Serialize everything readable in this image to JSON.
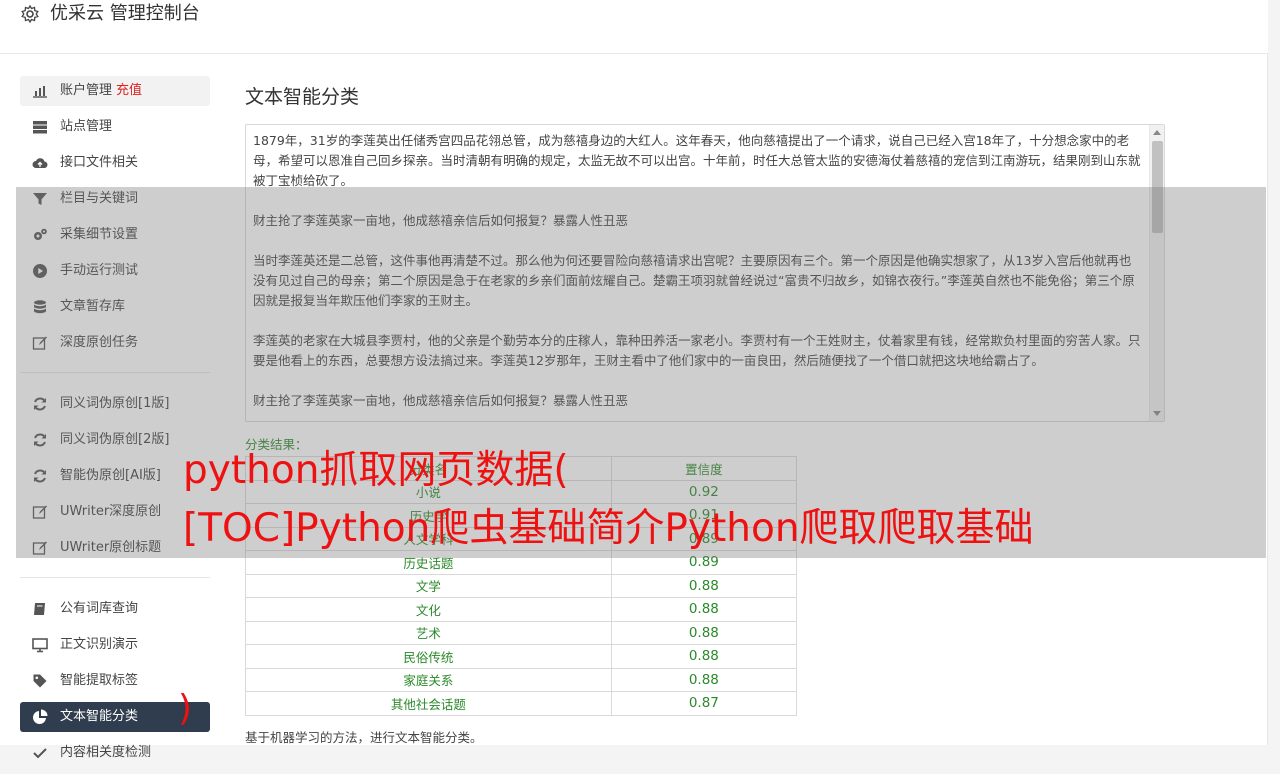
{
  "header": {
    "title": "优采云 管理控制台"
  },
  "sidebar": {
    "items": [
      {
        "label": "账户管理",
        "badge": "充值",
        "icon": "bar-chart-icon"
      },
      {
        "label": "站点管理",
        "icon": "server-icon"
      },
      {
        "label": "接口文件相关",
        "icon": "cloud-upload-icon"
      },
      {
        "label": "栏目与关键词",
        "icon": "filter-icon"
      },
      {
        "label": "采集细节设置",
        "icon": "gears-icon"
      },
      {
        "label": "手动运行测试",
        "icon": "play-icon"
      },
      {
        "label": "文章暂存库",
        "icon": "database-icon"
      },
      {
        "label": "深度原创任务",
        "icon": "edit-icon"
      }
    ],
    "items2": [
      {
        "label": "同义词伪原创[1版]",
        "icon": "refresh-icon"
      },
      {
        "label": "同义词伪原创[2版]",
        "icon": "refresh-icon"
      },
      {
        "label": "智能伪原创[AI版]",
        "icon": "refresh-icon"
      },
      {
        "label": "UWriter深度原创",
        "icon": "edit-icon"
      },
      {
        "label": "UWriter原创标题",
        "icon": "edit-icon"
      }
    ],
    "items3": [
      {
        "label": "公有词库查询",
        "icon": "book-icon"
      },
      {
        "label": "正文识别演示",
        "icon": "monitor-icon"
      },
      {
        "label": "智能提取标签",
        "icon": "tag-icon"
      },
      {
        "label": "文本智能分类",
        "icon": "pie-chart-icon"
      },
      {
        "label": "内容相关度检测",
        "icon": "check-icon"
      }
    ]
  },
  "main": {
    "title": "文本智能分类",
    "text_paragraphs": [
      "1879年，31岁的李莲英出任储秀宫四品花翎总管，成为慈禧身边的大红人。这年春天，他向慈禧提出了一个请求，说自己已经入宫18年了，十分想念家中的老母，希望可以恩准自己回乡探亲。当时清朝有明确的规定，太监无故不可以出宫。十年前，时任大总管太监的安德海仗着慈禧的宠信到江南游玩，结果刚到山东就被丁宝桢给砍了。",
      "财主抢了李莲英家一亩地，他成慈禧亲信后如何报复？暴露人性丑恶",
      "当时李莲英还是二总管，这件事他再清楚不过。那么他为何还要冒险向慈禧请求出宫呢？主要原因有三个。第一个原因是他确实想家了，从13岁入宫后他就再也没有见过自己的母亲；第二个原因是急于在老家的乡亲们面前炫耀自己。楚霸王项羽就曾经说过“富贵不归故乡，如锦衣夜行。”李莲英自然也不能免俗；第三个原因就是报复当年欺压他们李家的王财主。",
      "李莲英的老家在大城县李贾村，他的父亲是个勤劳本分的庄稼人，靠种田养活一家老小。李贾村有一个王姓财主，仗着家里有钱，经常欺负村里面的穷苦人家。只要是他看上的东西，总要想方设法搞过来。李莲英12岁那年，王财主看中了他们家中的一亩良田，然后随便找了一个借口就把这块地给霸占了。",
      "财主抢了李莲英家一亩地，他成慈禧亲信后如何报复？暴露人性丑恶"
    ],
    "result_label": "分类结果：",
    "table_headers": [
      "分类名",
      "置信度"
    ],
    "table_rows": [
      [
        "小说",
        "0.92"
      ],
      [
        "历史学",
        "0.91"
      ],
      [
        "人文学科",
        "0.89"
      ],
      [
        "历史话题",
        "0.89"
      ],
      [
        "文学",
        "0.88"
      ],
      [
        "文化",
        "0.88"
      ],
      [
        "艺术",
        "0.88"
      ],
      [
        "民俗传统",
        "0.88"
      ],
      [
        "家庭关系",
        "0.88"
      ],
      [
        "其他社会话题",
        "0.87"
      ]
    ],
    "footnote": "基于机器学习的方法，进行文本智能分类。"
  },
  "overlay": {
    "line1": "python抓取网页数据(",
    "line2": "[TOC]Python爬虫基础简介Python爬取爬取基础",
    "line3": ")"
  },
  "colors": {
    "accent_red": "#ee1111",
    "result_green": "#2a8a2a",
    "active_nav": "#2f3d4f"
  }
}
